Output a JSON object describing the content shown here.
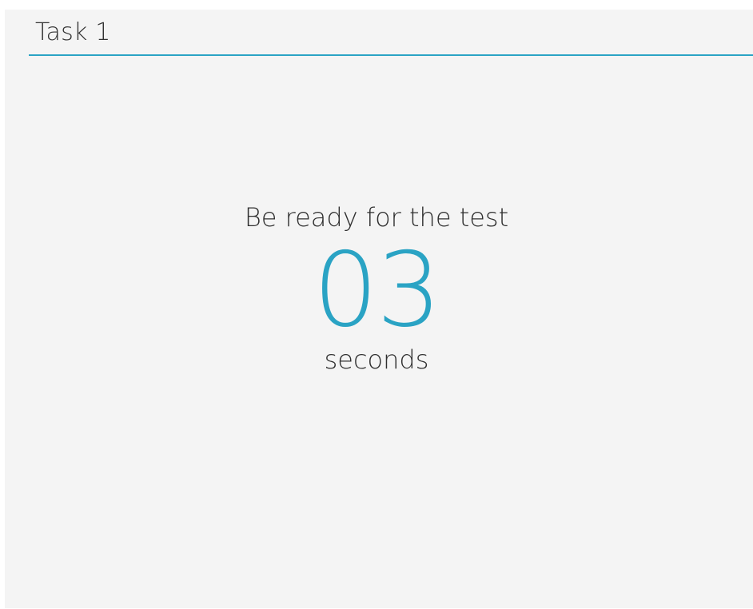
{
  "header": {
    "title": "Task 1"
  },
  "countdown": {
    "message": "Be ready for the test",
    "value": "03",
    "unit": "seconds"
  },
  "colors": {
    "accent": "#2aa3c4",
    "panel_background": "#f4f4f4",
    "text": "#2f2f2f"
  }
}
